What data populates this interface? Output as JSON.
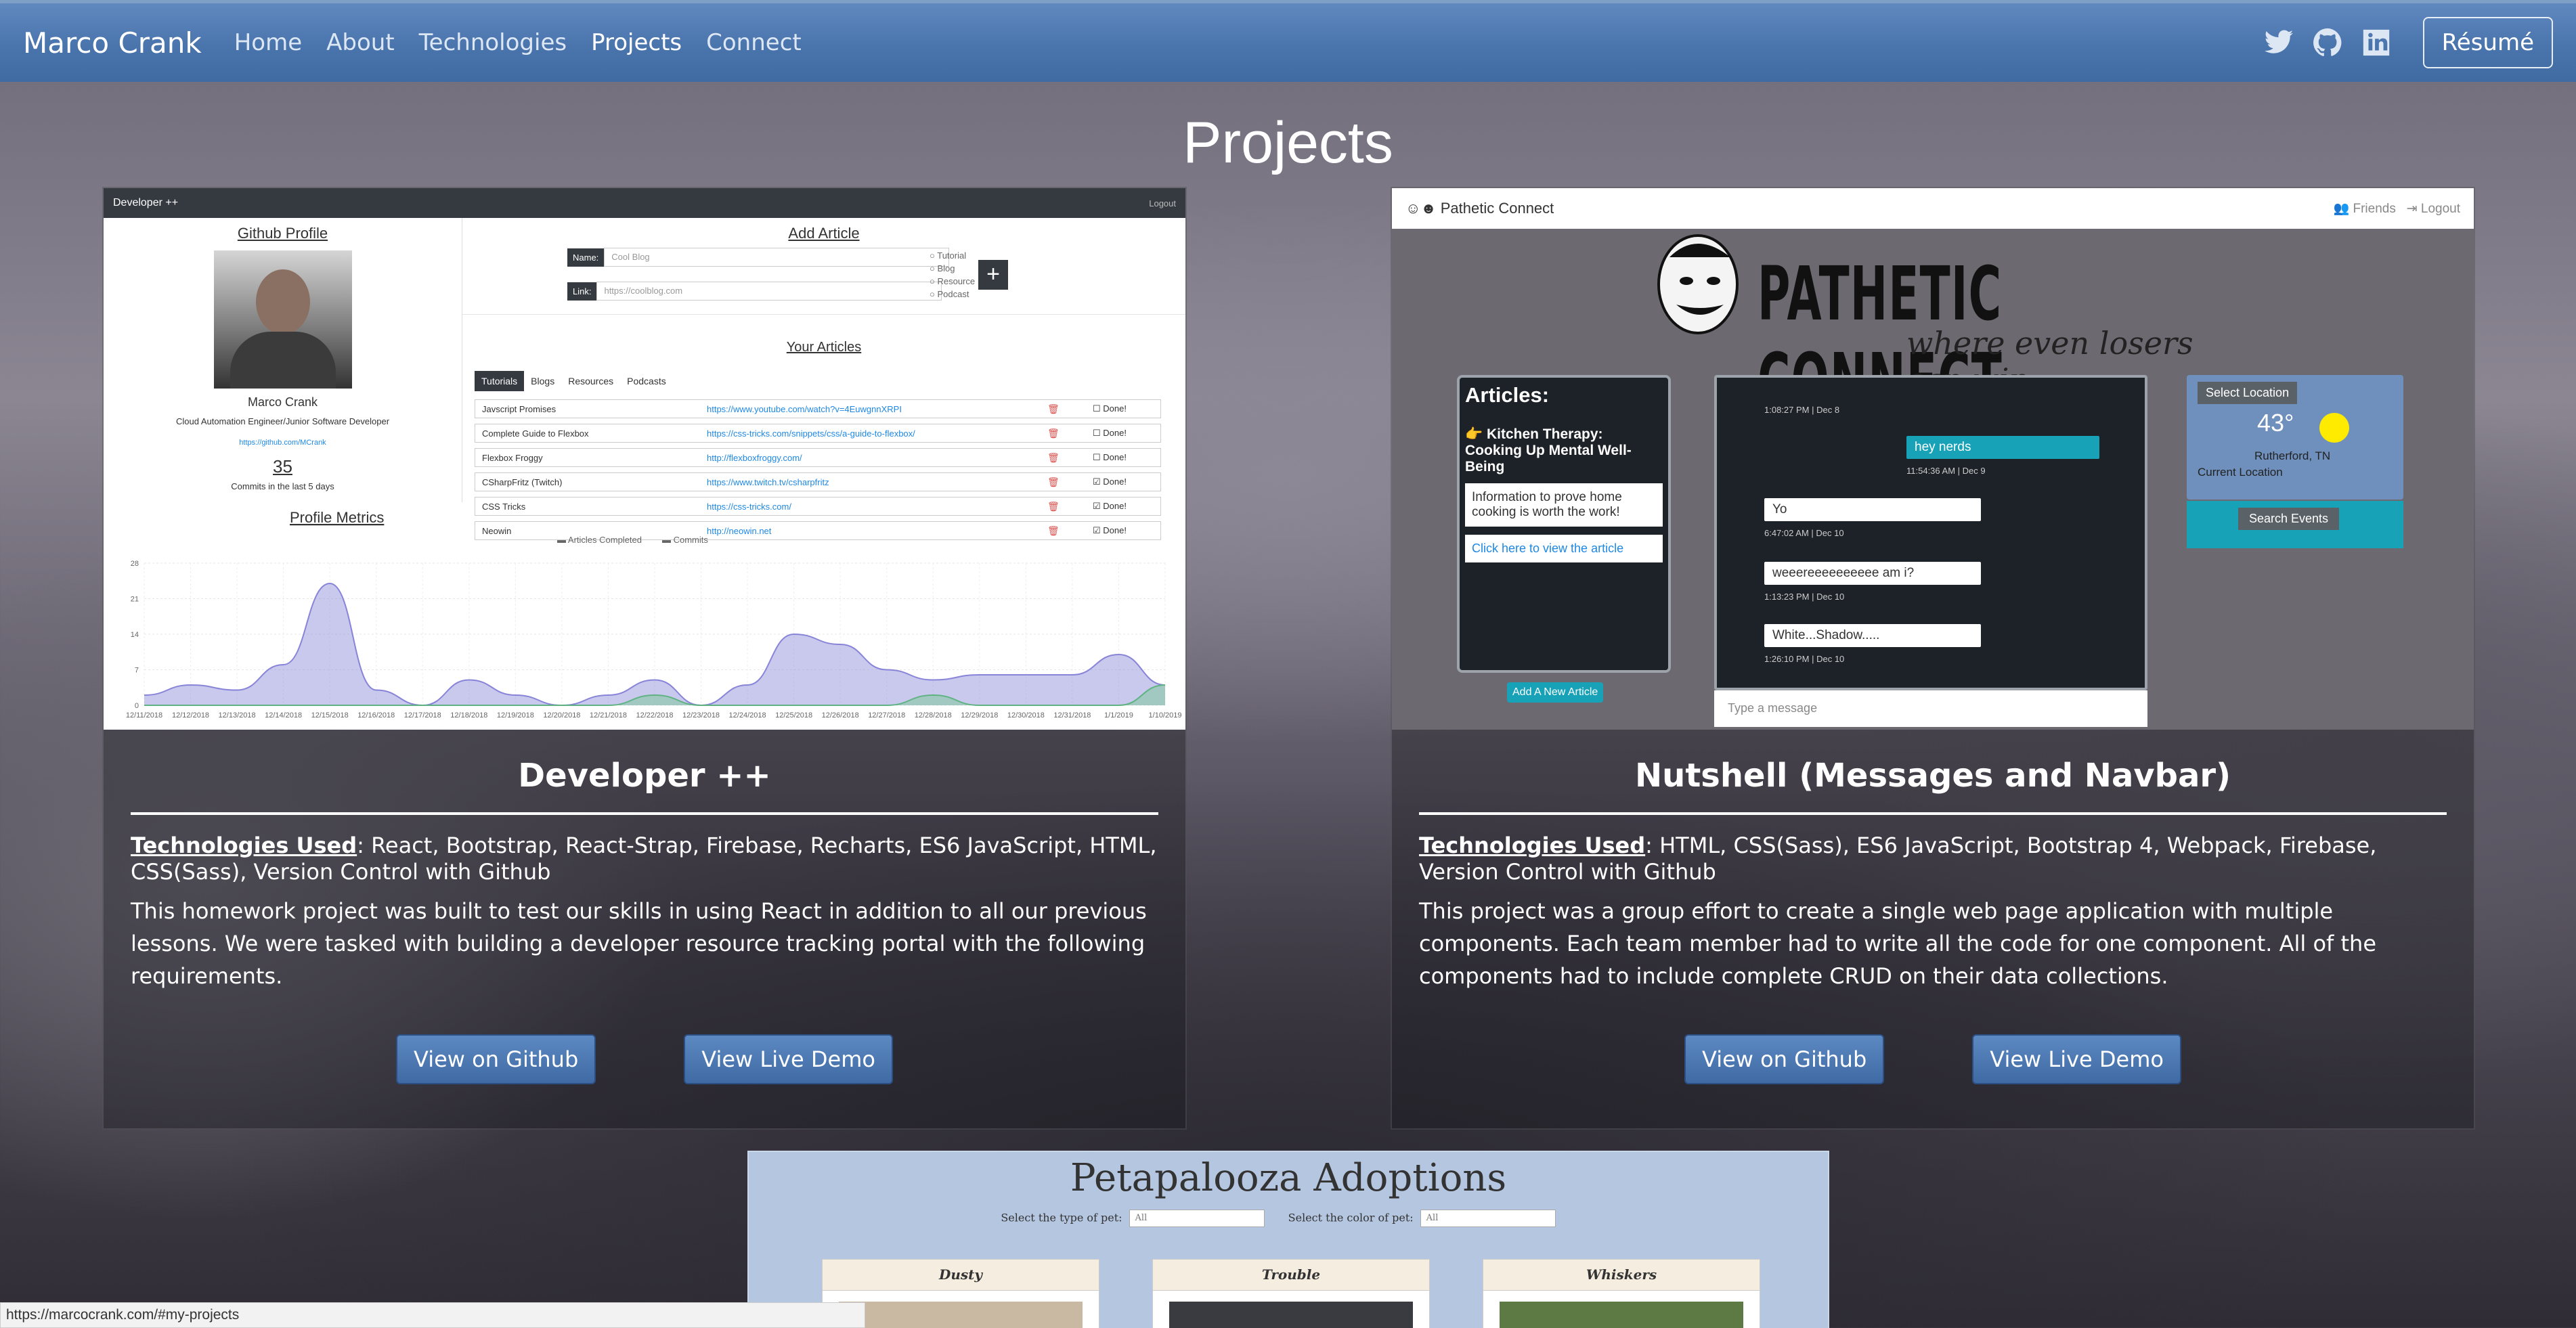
{
  "navbar": {
    "brand": "Marco Crank",
    "links": [
      "Home",
      "About",
      "Technologies",
      "Projects",
      "Connect"
    ],
    "active": "Projects",
    "social": [
      "twitter-icon",
      "github-icon",
      "linkedin-icon"
    ],
    "resume_label": "Résumé",
    "color": "#4a74ac"
  },
  "page": {
    "title": "Projects"
  },
  "projects": [
    {
      "title": "Developer ++",
      "tech_label": "Technologies Used",
      "tech": "React, Bootstrap, React-Strap, Firebase, Recharts, ES6 JavaScript, HTML, CSS(Sass), Version Control with Github",
      "description": "This homework project was built to test our skills in using React in addition to all our previous lessons. We were tasked with building a developer resource tracking portal with the following requirements.",
      "github_label": "View on Github",
      "demo_label": "View Live Demo"
    },
    {
      "title": "Nutshell (Messages and Navbar)",
      "tech_label": "Technologies Used",
      "tech": "HTML, CSS(Sass), ES6 JavaScript, Bootstrap 4, Webpack, Firebase, Version Control with Github",
      "description": "This project was a group effort to create a single web page application with multiple components. Each team member had to write all the code for one component. All of the components had to include complete CRUD on their data collections.",
      "github_label": "View on Github",
      "demo_label": "View Live Demo"
    }
  ],
  "devshot": {
    "brand": "Developer ++",
    "logout": "Logout",
    "github_profile": "Github Profile",
    "name": "Marco Crank",
    "subtitle": "Cloud Automation Engineer/Junior Software Developer",
    "profile_link": "https://github.com/MCrank",
    "commits": "35",
    "commits_caption": "Commits in the last 5 days",
    "add_article": "Add Article",
    "name_label": "Name:",
    "name_value": "Cool Blog",
    "link_label": "Link:",
    "link_value": "https://coolblog.com",
    "types": [
      "Tutorial",
      "Blog",
      "Resource",
      "Podcast"
    ],
    "your_articles": "Your Articles",
    "tabs": [
      "Tutorials",
      "Blogs",
      "Resources",
      "Podcasts"
    ],
    "done_label": "Done!",
    "articles": [
      {
        "name": "Javscript Promises",
        "url": "https://www.youtube.com/watch?v=4EuwgnnXRPI",
        "done": false
      },
      {
        "name": "Complete Guide to Flexbox",
        "url": "https://css-tricks.com/snippets/css/a-guide-to-flexbox/",
        "done": false
      },
      {
        "name": "Flexbox Froggy",
        "url": "http://flexboxfroggy.com/",
        "done": false
      },
      {
        "name": "CSharpFritz (Twitch)",
        "url": "https://www.twitch.tv/csharpfritz",
        "done": true
      },
      {
        "name": "CSS Tricks",
        "url": "https://css-tricks.com/",
        "done": true
      },
      {
        "name": "Neowin",
        "url": "http://neowin.net",
        "done": true
      }
    ],
    "metrics_title": "Profile Metrics",
    "legend": [
      "Articles Completed",
      "Commits"
    ],
    "yticks": [
      "28",
      "21",
      "14",
      "7",
      "0"
    ],
    "chart_data": {
      "type": "area",
      "x": [
        "12/11/2018",
        "12/12/2018",
        "12/13/2018",
        "12/14/2018",
        "12/15/2018",
        "12/16/2018",
        "12/17/2018",
        "12/18/2018",
        "12/19/2018",
        "12/20/2018",
        "12/21/2018",
        "12/22/2018",
        "12/23/2018",
        "12/24/2018",
        "12/25/2018",
        "12/26/2018",
        "12/27/2018",
        "12/28/2018",
        "12/29/2018",
        "12/30/2018",
        "12/31/2018",
        "1/1/2019",
        "1/10/2019"
      ],
      "series": [
        {
          "name": "Articles Completed",
          "values": [
            0,
            0,
            0,
            0,
            0,
            0,
            0,
            0,
            0,
            0,
            0,
            2,
            0,
            0,
            0,
            0,
            0,
            2,
            0,
            0,
            0,
            0,
            4
          ]
        },
        {
          "name": "Commits",
          "values": [
            2,
            4,
            3,
            8,
            24,
            3,
            0,
            5,
            2,
            0,
            2,
            5,
            0,
            4,
            14,
            12,
            7,
            5,
            6,
            6,
            6,
            10,
            4
          ]
        }
      ],
      "ylim": [
        0,
        28
      ]
    }
  },
  "nutshot": {
    "brand": "Pathetic Connect",
    "friends": "Friends",
    "logout": "Logout",
    "logo": "PATHETIC CONNECT",
    "tagline": "where even losers can win",
    "articles_heading": "Articles:",
    "article_title": "👉 Kitchen Therapy: Cooking Up Mental Well-Being",
    "article_synopsis": "Information to prove home cooking is worth the work!",
    "article_link": "Click here to view the article",
    "add_article": "Add A New Article",
    "messages": [
      {
        "text": "",
        "time": "1:08:27 PM | Dec 8"
      },
      {
        "text": "hey nerds",
        "time": "11:54:36 AM | Dec 9"
      },
      {
        "text": "Yo",
        "time": "6:47:02 AM | Dec 10"
      },
      {
        "text": "weeereeeeeeeeee am i?",
        "time": "1:13:23 PM | Dec 10"
      },
      {
        "text": "White...Shadow.....",
        "time": "1:26:10 PM | Dec 10"
      }
    ],
    "message_placeholder": "Type a message",
    "select_location": "Select Location",
    "temp": "43°",
    "city": "Rutherford, TN",
    "current_location": "Current Location",
    "search_events": "Search Events"
  },
  "petapalooza": {
    "title": "Petapalooza Adoptions",
    "type_label": "Select the type of pet:",
    "color_label": "Select the color of pet:",
    "all": "All",
    "pets": [
      "Dusty",
      "Trouble",
      "Whiskers"
    ]
  },
  "statusbar": {
    "url": "https://marcocrank.com/#my-projects"
  }
}
